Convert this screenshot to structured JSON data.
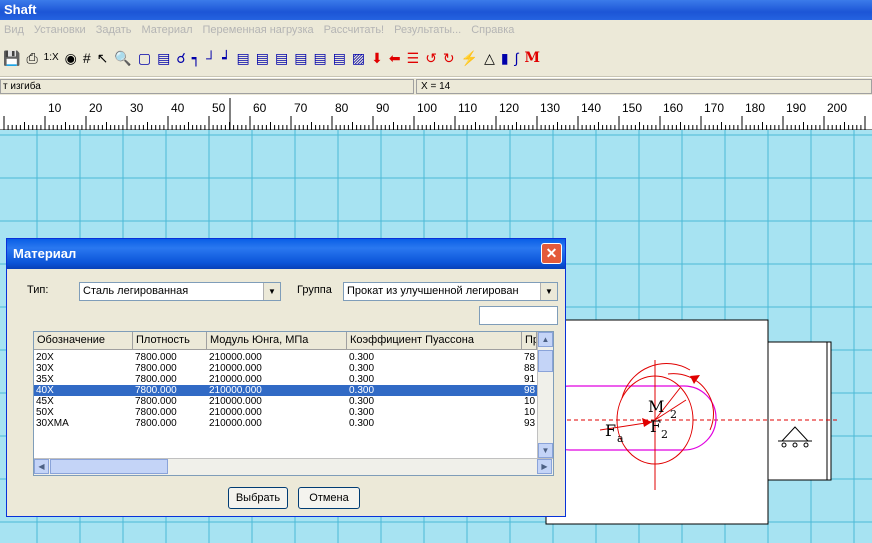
{
  "app": {
    "title": "Shaft"
  },
  "menu": [
    "Вид",
    "Установки",
    "Задать",
    "Материал",
    "Переменная нагрузка",
    "Рассчитать!",
    "Результаты...",
    "Справка"
  ],
  "toolbar": {
    "icons": [
      "save-icon",
      "print-icon",
      "scale-1x-icon",
      "binoculars-icon",
      "grid-icon",
      "arrow-select-icon",
      "zoom-icon",
      "frame-icon",
      "shaft-segment-icon",
      "bearing-icon",
      "step-icon",
      "groove-icon",
      "shoulder-icon",
      "rect-1-icon",
      "rect-2-icon",
      "rect-3-icon",
      "rect-4-icon",
      "rect-5-icon",
      "rect-6-icon",
      "fan-icon",
      "force-down-icon",
      "force-left-icon",
      "distributed-load-icon",
      "moment-ccw-icon",
      "moment-cw-icon",
      "lightning-icon",
      "support-icon",
      "bottle-icon",
      "spring-icon",
      "moment-m-icon"
    ]
  },
  "status": {
    "left": "т изгиба",
    "right": "X = 14"
  },
  "ruler": {
    "ticks": [
      "10",
      "20",
      "30",
      "40",
      "50",
      "60",
      "70",
      "80",
      "90",
      "100",
      "110",
      "120",
      "130",
      "140",
      "150",
      "160",
      "170",
      "180",
      "190",
      "200"
    ]
  },
  "drawing": {
    "labels": {
      "fa": "F",
      "fa_sub": "a",
      "f2": "F",
      "f2_sub": "2",
      "m": "M",
      "m_sub": "2"
    }
  },
  "dialog": {
    "title": "Материал",
    "close": "✕",
    "type_label": "Тип:",
    "type_value": "Сталь легированная",
    "group_label": "Группа",
    "group_value": "Прокат из улучшенной легирован",
    "columns": [
      "Обозначение",
      "Плотность",
      "Модуль Юнга, МПа",
      "Коэффициент Пуассона",
      "Пр"
    ],
    "rows": [
      [
        "20X",
        "7800.000",
        "210000.000",
        "0.300",
        "78"
      ],
      [
        "30X",
        "7800.000",
        "210000.000",
        "0.300",
        "88"
      ],
      [
        "35X",
        "7800.000",
        "210000.000",
        "0.300",
        "91"
      ],
      [
        "40X",
        "7800.000",
        "210000.000",
        "0.300",
        "98"
      ],
      [
        "45X",
        "7800.000",
        "210000.000",
        "0.300",
        "10"
      ],
      [
        "50X",
        "7800.000",
        "210000.000",
        "0.300",
        "10"
      ],
      [
        "30XMA",
        "7800.000",
        "210000.000",
        "0.300",
        "93"
      ]
    ],
    "selected_row": 3,
    "ok_label": "Выбрать",
    "cancel_label": "Отмена"
  }
}
